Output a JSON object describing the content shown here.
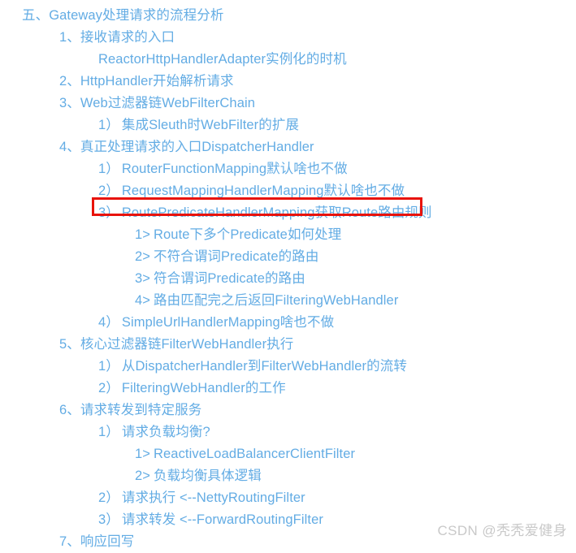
{
  "document": {
    "title": "五、Gateway处理请求的流程分析",
    "text_color": "#63ACE4",
    "highlight_color": "#E8130A",
    "background_color": "#FFFFFF",
    "watermark_color": "#C9C9C9"
  },
  "outline": [
    {
      "level": 1,
      "marker": "五、",
      "text": "Gateway处理请求的流程分析",
      "highlighted": false
    },
    {
      "level": 2,
      "marker": "1、",
      "text": "接收请求的入口",
      "highlighted": false
    },
    {
      "level": 3,
      "marker": "",
      "text": "ReactorHttpHandlerAdapter实例化的时机",
      "highlighted": false
    },
    {
      "level": 2,
      "marker": "2、",
      "text": "HttpHandler开始解析请求",
      "highlighted": false
    },
    {
      "level": 2,
      "marker": "3、",
      "text": "Web过滤器链WebFilterChain",
      "highlighted": false
    },
    {
      "level": 3,
      "marker": "1）",
      "text": "集成Sleuth时WebFilter的扩展",
      "highlighted": false
    },
    {
      "level": 2,
      "marker": "4、",
      "text": "真正处理请求的入口DispatcherHandler",
      "highlighted": false
    },
    {
      "level": 3,
      "marker": "1）",
      "text": "RouterFunctionMapping默认啥也不做",
      "highlighted": false
    },
    {
      "level": 3,
      "marker": "2）",
      "text": "RequestMappingHandlerMapping默认啥也不做",
      "highlighted": false
    },
    {
      "level": 3,
      "marker": "3）",
      "text": "RoutePredicateHandlerMapping获取Route路由规则",
      "highlighted": true
    },
    {
      "level": 4,
      "marker": "1>",
      "text": "Route下多个Predicate如何处理",
      "highlighted": false
    },
    {
      "level": 4,
      "marker": "2>",
      "text": "不符合谓词Predicate的路由",
      "highlighted": false
    },
    {
      "level": 4,
      "marker": "3>",
      "text": "符合谓词Predicate的路由",
      "highlighted": false
    },
    {
      "level": 4,
      "marker": "4>",
      "text": "路由匹配完之后返回FilteringWebHandler",
      "highlighted": false
    },
    {
      "level": 3,
      "marker": "4）",
      "text": "SimpleUrlHandlerMapping啥也不做",
      "highlighted": false
    },
    {
      "level": 2,
      "marker": "5、",
      "text": "核心过滤器链FilterWebHandler执行",
      "highlighted": false
    },
    {
      "level": 3,
      "marker": "1）",
      "text": "从DispatcherHandler到FilterWebHandler的流转",
      "highlighted": false
    },
    {
      "level": 3,
      "marker": "2）",
      "text": "FilteringWebHandler的工作",
      "highlighted": false
    },
    {
      "level": 2,
      "marker": "6、",
      "text": "请求转发到特定服务",
      "highlighted": false
    },
    {
      "level": 3,
      "marker": "1）",
      "text": "请求负载均衡?",
      "highlighted": false
    },
    {
      "level": 4,
      "marker": "1>",
      "text": "ReactiveLoadBalancerClientFilter",
      "highlighted": false
    },
    {
      "level": 4,
      "marker": "2>",
      "text": "负载均衡具体逻辑",
      "highlighted": false
    },
    {
      "level": 3,
      "marker": "2）",
      "text": "请求执行 <--NettyRoutingFilter",
      "highlighted": false
    },
    {
      "level": 3,
      "marker": "3）",
      "text": "请求转发 <--ForwardRoutingFilter",
      "highlighted": false
    },
    {
      "level": 2,
      "marker": "7、",
      "text": "响应回写",
      "highlighted": false
    }
  ],
  "watermark": {
    "text": "CSDN @秃秃爱健身"
  }
}
